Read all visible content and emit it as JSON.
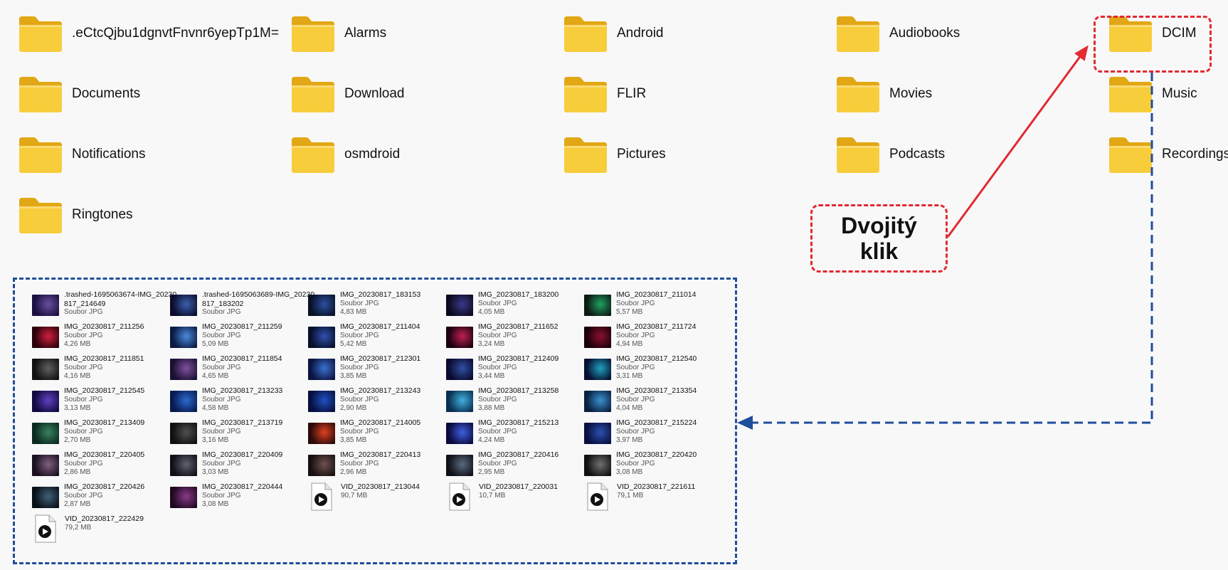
{
  "folders": [
    {
      "name": ".eCtcQjbu1dgnvtFnvnr6yepTp1M="
    },
    {
      "name": "Alarms"
    },
    {
      "name": "Android"
    },
    {
      "name": "Audiobooks"
    },
    {
      "name": "DCIM"
    },
    {
      "name": "Documents"
    },
    {
      "name": "Download"
    },
    {
      "name": "FLIR"
    },
    {
      "name": "Movies"
    },
    {
      "name": "Music"
    },
    {
      "name": "Notifications"
    },
    {
      "name": "osmdroid"
    },
    {
      "name": "Pictures"
    },
    {
      "name": "Podcasts"
    },
    {
      "name": "Recordings"
    },
    {
      "name": "Ringtones"
    }
  ],
  "callout": {
    "line1": "Dvojitý",
    "line2": "klik"
  },
  "files": [
    {
      "name": ".trashed-1695063674-IMG_20230817_214649",
      "type": "Soubor JPG",
      "size": "",
      "icon": "image-thumbnail"
    },
    {
      "name": ".trashed-1695063689-IMG_20230817_183202",
      "type": "Soubor JPG",
      "size": "",
      "icon": "image-thumbnail"
    },
    {
      "name": "IMG_20230817_183153",
      "type": "Soubor JPG",
      "size": "4,83 MB",
      "icon": "image-thumbnail"
    },
    {
      "name": "IMG_20230817_183200",
      "type": "Soubor JPG",
      "size": "4,05 MB",
      "icon": "image-thumbnail"
    },
    {
      "name": "IMG_20230817_211014",
      "type": "Soubor JPG",
      "size": "5,57 MB",
      "icon": "image-thumbnail"
    },
    {
      "name": "IMG_20230817_211256",
      "type": "Soubor JPG",
      "size": "4,26 MB",
      "icon": "image-thumbnail"
    },
    {
      "name": "IMG_20230817_211259",
      "type": "Soubor JPG",
      "size": "5,09 MB",
      "icon": "image-thumbnail"
    },
    {
      "name": "IMG_20230817_211404",
      "type": "Soubor JPG",
      "size": "5,42 MB",
      "icon": "image-thumbnail"
    },
    {
      "name": "IMG_20230817_211652",
      "type": "Soubor JPG",
      "size": "3,24 MB",
      "icon": "image-thumbnail"
    },
    {
      "name": "IMG_20230817_211724",
      "type": "Soubor JPG",
      "size": "4,94 MB",
      "icon": "image-thumbnail"
    },
    {
      "name": "IMG_20230817_211851",
      "type": "Soubor JPG",
      "size": "4,16 MB",
      "icon": "image-thumbnail"
    },
    {
      "name": "IMG_20230817_211854",
      "type": "Soubor JPG",
      "size": "4,65 MB",
      "icon": "image-thumbnail"
    },
    {
      "name": "IMG_20230817_212301",
      "type": "Soubor JPG",
      "size": "3,85 MB",
      "icon": "image-thumbnail"
    },
    {
      "name": "IMG_20230817_212409",
      "type": "Soubor JPG",
      "size": "3,44 MB",
      "icon": "image-thumbnail"
    },
    {
      "name": "IMG_20230817_212540",
      "type": "Soubor JPG",
      "size": "3,31 MB",
      "icon": "image-thumbnail"
    },
    {
      "name": "IMG_20230817_212545",
      "type": "Soubor JPG",
      "size": "3,13 MB",
      "icon": "image-thumbnail"
    },
    {
      "name": "IMG_20230817_213233",
      "type": "Soubor JPG",
      "size": "4,58 MB",
      "icon": "image-thumbnail"
    },
    {
      "name": "IMG_20230817_213243",
      "type": "Soubor JPG",
      "size": "2,90 MB",
      "icon": "image-thumbnail"
    },
    {
      "name": "IMG_20230817_213258",
      "type": "Soubor JPG",
      "size": "3,88 MB",
      "icon": "image-thumbnail"
    },
    {
      "name": "IMG_20230817_213354",
      "type": "Soubor JPG",
      "size": "4,04 MB",
      "icon": "image-thumbnail"
    },
    {
      "name": "IMG_20230817_213409",
      "type": "Soubor JPG",
      "size": "2,70 MB",
      "icon": "image-thumbnail"
    },
    {
      "name": "IMG_20230817_213719",
      "type": "Soubor JPG",
      "size": "3,16 MB",
      "icon": "image-thumbnail"
    },
    {
      "name": "IMG_20230817_214005",
      "type": "Soubor JPG",
      "size": "3,85 MB",
      "icon": "image-thumbnail"
    },
    {
      "name": "IMG_20230817_215213",
      "type": "Soubor JPG",
      "size": "4,24 MB",
      "icon": "image-thumbnail"
    },
    {
      "name": "IMG_20230817_215224",
      "type": "Soubor JPG",
      "size": "3,97 MB",
      "icon": "image-thumbnail"
    },
    {
      "name": "IMG_20230817_220405",
      "type": "Soubor JPG",
      "size": "2,86 MB",
      "icon": "image-thumbnail"
    },
    {
      "name": "IMG_20230817_220409",
      "type": "Soubor JPG",
      "size": "3,03 MB",
      "icon": "image-thumbnail"
    },
    {
      "name": "IMG_20230817_220413",
      "type": "Soubor JPG",
      "size": "2,96 MB",
      "icon": "image-thumbnail"
    },
    {
      "name": "IMG_20230817_220416",
      "type": "Soubor JPG",
      "size": "2,95 MB",
      "icon": "image-thumbnail"
    },
    {
      "name": "IMG_20230817_220420",
      "type": "Soubor JPG",
      "size": "3,08 MB",
      "icon": "image-thumbnail"
    },
    {
      "name": "IMG_20230817_220426",
      "type": "Soubor JPG",
      "size": "2,87 MB",
      "icon": "image-thumbnail"
    },
    {
      "name": "IMG_20230817_220444",
      "type": "Soubor JPG",
      "size": "3,08 MB",
      "icon": "image-thumbnail"
    },
    {
      "name": "VID_20230817_213044",
      "type": "",
      "size": "90,7 MB",
      "icon": "video-file-icon"
    },
    {
      "name": "VID_20230817_220031",
      "type": "",
      "size": "10,7 MB",
      "icon": "video-file-icon"
    },
    {
      "name": "VID_20230817_221611",
      "type": "",
      "size": "79,1 MB",
      "icon": "video-file-icon"
    },
    {
      "name": "VID_20230817_222429",
      "type": "",
      "size": "79,2 MB",
      "icon": "video-file-icon"
    }
  ],
  "colors": {
    "folder": "#f4c430",
    "folder_dark": "#e2a714",
    "highlight_red": "#e12a32",
    "highlight_blue": "#1f4e9a"
  }
}
